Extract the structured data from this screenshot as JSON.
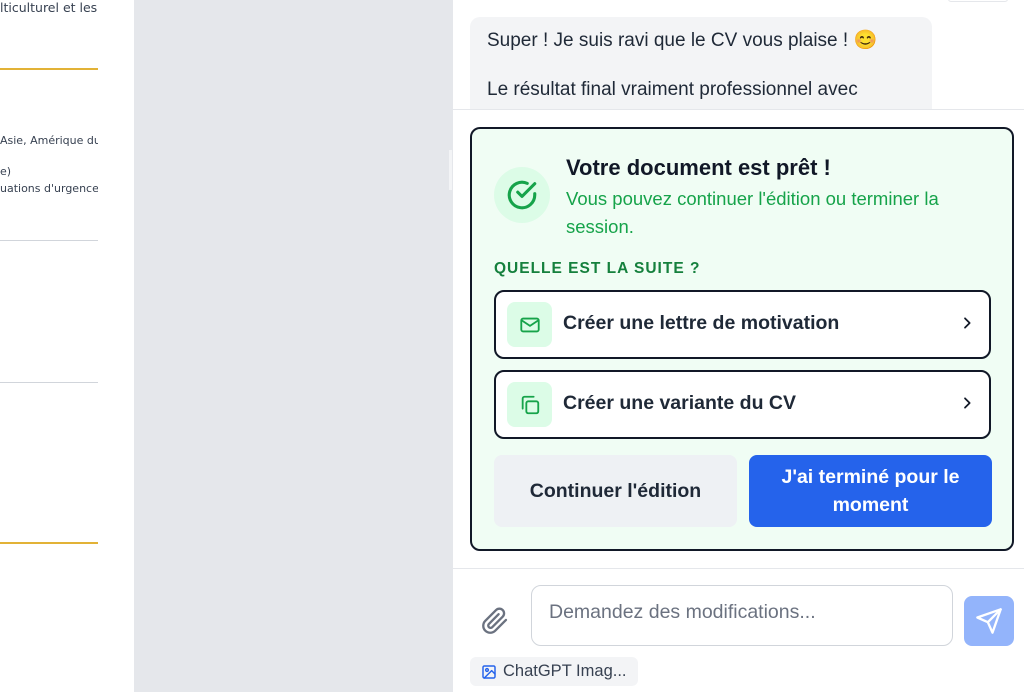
{
  "document_preview": {
    "line1": "lticulturel et les",
    "line2": "Asie, Amérique du",
    "line3": "e)",
    "line4": "uations d'urgence"
  },
  "chat": {
    "message": {
      "line1": "Super ! Je suis ravi que le CV vous plaise ! 😊",
      "line2": "Le résultat final vraiment professionnel avec"
    },
    "ready_card": {
      "title": "Votre document est prêt !",
      "subtitle": "Vous pouvez continuer l'édition ou terminer la session.",
      "next_heading": "QUELLE EST LA SUITE ?",
      "options": [
        {
          "label": "Créer une lettre de motivation",
          "icon": "mail-icon"
        },
        {
          "label": "Créer une variante du CV",
          "icon": "copy-icon"
        }
      ],
      "continue_label": "Continuer l'édition",
      "done_label": "J'ai terminé pour le moment"
    },
    "composer": {
      "placeholder": "Demandez des modifications...",
      "attachment_name": "ChatGPT Imag..."
    }
  },
  "colors": {
    "accent_blue": "#2563eb",
    "success_green": "#16a34a",
    "card_bg": "#f0fdf4",
    "doc_rule_gold": "#e2b236"
  }
}
